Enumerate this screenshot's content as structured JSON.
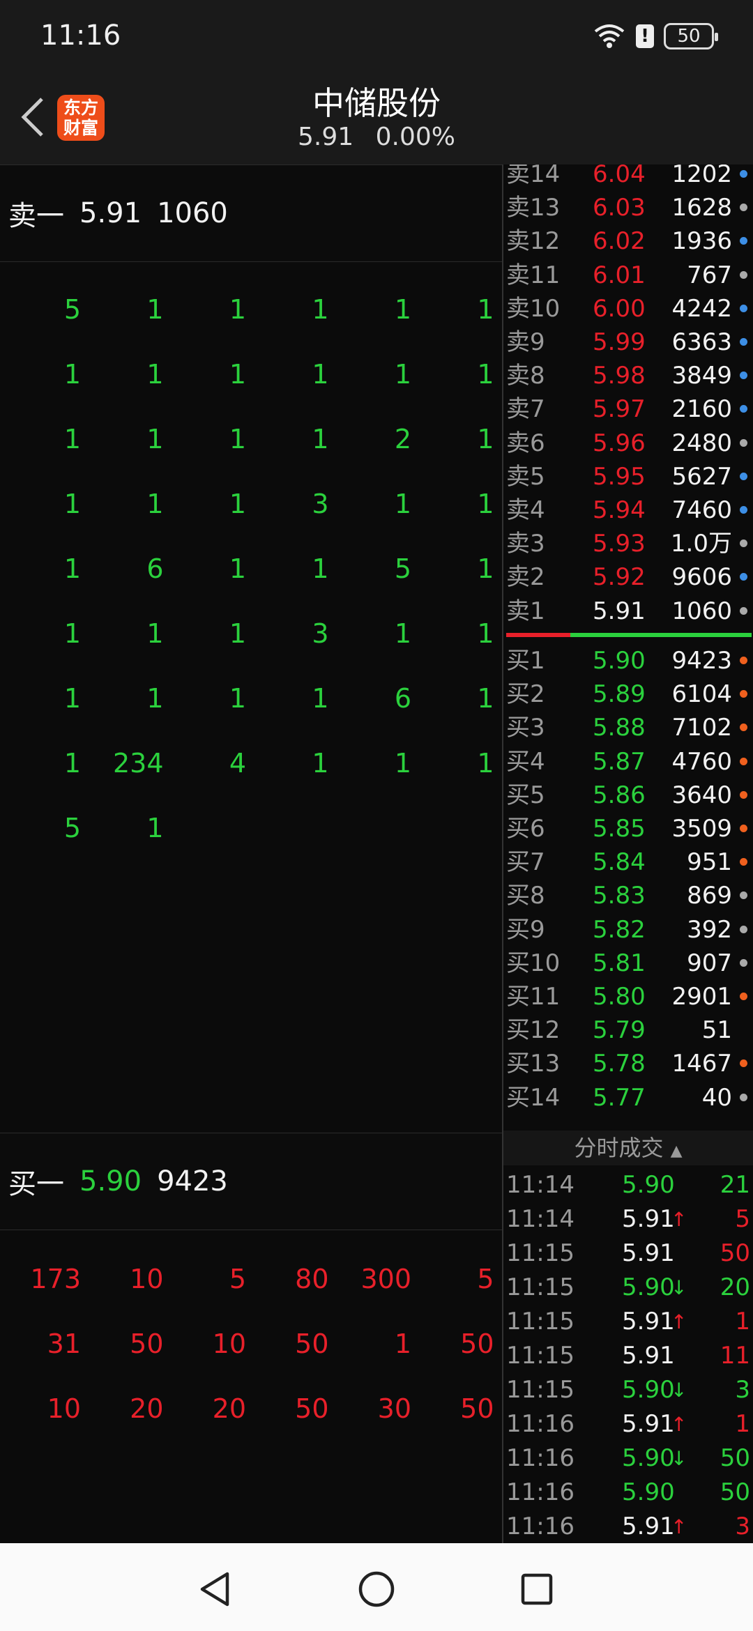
{
  "status_bar": {
    "time": "11:16",
    "battery": "50",
    "alert": "!"
  },
  "header": {
    "title": "中储股份",
    "price": "5.91",
    "change_pct": "0.00%",
    "logo_line1": "东方",
    "logo_line2": "财富"
  },
  "ask_head": {
    "label": "卖一",
    "price": "5.91",
    "volume": "1060"
  },
  "bid_head": {
    "label": "买一",
    "price": "5.90",
    "volume": "9423"
  },
  "ask_queue": [
    [
      "5",
      "1",
      "1",
      "1",
      "1",
      "1"
    ],
    [
      "1",
      "1",
      "1",
      "1",
      "1",
      "1"
    ],
    [
      "1",
      "1",
      "1",
      "1",
      "2",
      "1"
    ],
    [
      "1",
      "1",
      "1",
      "3",
      "1",
      "1"
    ],
    [
      "1",
      "6",
      "1",
      "1",
      "5",
      "1"
    ],
    [
      "1",
      "1",
      "1",
      "3",
      "1",
      "1"
    ],
    [
      "1",
      "1",
      "1",
      "1",
      "6",
      "1"
    ],
    [
      "1",
      "234",
      "4",
      "1",
      "1",
      "1"
    ],
    [
      "5",
      "1",
      "",
      "",
      "",
      ""
    ]
  ],
  "bid_queue": [
    [
      "173",
      "10",
      "5",
      "80",
      "300",
      "5"
    ],
    [
      "31",
      "50",
      "10",
      "50",
      "1",
      "50"
    ],
    [
      "10",
      "20",
      "20",
      "50",
      "30",
      "50"
    ]
  ],
  "order_book": {
    "asks": [
      {
        "label": "卖14",
        "price": "6.04",
        "volume": "1202",
        "dot": "blue"
      },
      {
        "label": "卖13",
        "price": "6.03",
        "volume": "1628",
        "dot": "grey"
      },
      {
        "label": "卖12",
        "price": "6.02",
        "volume": "1936",
        "dot": "blue"
      },
      {
        "label": "卖11",
        "price": "6.01",
        "volume": "767",
        "dot": "grey"
      },
      {
        "label": "卖10",
        "price": "6.00",
        "volume": "4242",
        "dot": "blue"
      },
      {
        "label": "卖9",
        "price": "5.99",
        "volume": "6363",
        "dot": "blue"
      },
      {
        "label": "卖8",
        "price": "5.98",
        "volume": "3849",
        "dot": "blue"
      },
      {
        "label": "卖7",
        "price": "5.97",
        "volume": "2160",
        "dot": "blue"
      },
      {
        "label": "卖6",
        "price": "5.96",
        "volume": "2480",
        "dot": "grey"
      },
      {
        "label": "卖5",
        "price": "5.95",
        "volume": "5627",
        "dot": "blue"
      },
      {
        "label": "卖4",
        "price": "5.94",
        "volume": "7460",
        "dot": "blue"
      },
      {
        "label": "卖3",
        "price": "5.93",
        "volume": "1.0万",
        "dot": "grey"
      },
      {
        "label": "卖2",
        "price": "5.92",
        "volume": "9606",
        "dot": "blue"
      },
      {
        "label": "卖1",
        "price": "5.91",
        "volume": "1060",
        "dot": "grey"
      }
    ],
    "bids": [
      {
        "label": "买1",
        "price": "5.90",
        "volume": "9423",
        "dot": "orange"
      },
      {
        "label": "买2",
        "price": "5.89",
        "volume": "6104",
        "dot": "orange"
      },
      {
        "label": "买3",
        "price": "5.88",
        "volume": "7102",
        "dot": "orange"
      },
      {
        "label": "买4",
        "price": "5.87",
        "volume": "4760",
        "dot": "orange"
      },
      {
        "label": "买5",
        "price": "5.86",
        "volume": "3640",
        "dot": "orange"
      },
      {
        "label": "买6",
        "price": "5.85",
        "volume": "3509",
        "dot": "orange"
      },
      {
        "label": "买7",
        "price": "5.84",
        "volume": "951",
        "dot": "orange"
      },
      {
        "label": "买8",
        "price": "5.83",
        "volume": "869",
        "dot": "grey"
      },
      {
        "label": "买9",
        "price": "5.82",
        "volume": "392",
        "dot": "grey"
      },
      {
        "label": "买10",
        "price": "5.81",
        "volume": "907",
        "dot": "grey"
      },
      {
        "label": "买11",
        "price": "5.80",
        "volume": "2901",
        "dot": "orange"
      },
      {
        "label": "买12",
        "price": "5.79",
        "volume": "51",
        "dot": "none"
      },
      {
        "label": "买13",
        "price": "5.78",
        "volume": "1467",
        "dot": "orange"
      },
      {
        "label": "买14",
        "price": "5.77",
        "volume": "40",
        "dot": "grey"
      }
    ]
  },
  "trades": {
    "title": "分时成交",
    "rows": [
      {
        "time": "11:14",
        "price": "5.90",
        "dir": "",
        "volume": "21",
        "color": "green"
      },
      {
        "time": "11:14",
        "price": "5.91",
        "dir": "up",
        "volume": "5",
        "color": "white"
      },
      {
        "time": "11:15",
        "price": "5.91",
        "dir": "",
        "volume": "50",
        "color": "white"
      },
      {
        "time": "11:15",
        "price": "5.90",
        "dir": "down",
        "volume": "20",
        "color": "green"
      },
      {
        "time": "11:15",
        "price": "5.91",
        "dir": "up",
        "volume": "1",
        "color": "white"
      },
      {
        "time": "11:15",
        "price": "5.91",
        "dir": "",
        "volume": "11",
        "color": "white"
      },
      {
        "time": "11:15",
        "price": "5.90",
        "dir": "down",
        "volume": "3",
        "color": "green"
      },
      {
        "time": "11:16",
        "price": "5.91",
        "dir": "up",
        "volume": "1",
        "color": "white"
      },
      {
        "time": "11:16",
        "price": "5.90",
        "dir": "down",
        "volume": "50",
        "color": "green"
      },
      {
        "time": "11:16",
        "price": "5.90",
        "dir": "",
        "volume": "50",
        "color": "green"
      },
      {
        "time": "11:16",
        "price": "5.91",
        "dir": "up",
        "volume": "3",
        "color": "white"
      }
    ]
  },
  "colors": {
    "red": "#e8202a",
    "green": "#2bd13d",
    "white": "#f2f2f2",
    "dot_blue": "#3d8fe6",
    "dot_grey": "#aaaaaa",
    "dot_orange": "#f0601e"
  }
}
